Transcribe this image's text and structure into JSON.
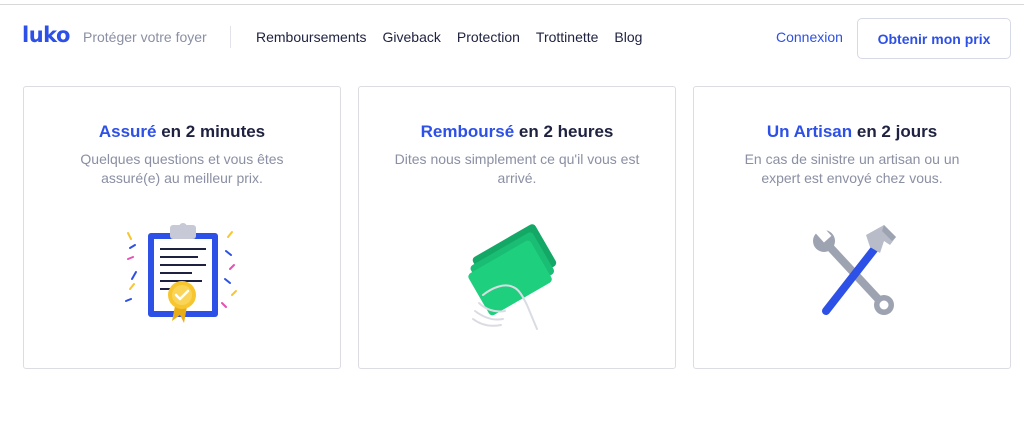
{
  "header": {
    "logo": "luko",
    "tagline": "Protéger votre foyer",
    "nav": [
      "Remboursements",
      "Giveback",
      "Protection",
      "Trottinette",
      "Blog"
    ],
    "login": "Connexion",
    "cta": "Obtenir mon prix"
  },
  "cards": [
    {
      "title_accent": "Assuré",
      "title_rest": " en 2 minutes",
      "description": "Quelques questions et vous êtes assuré(e) au meilleur prix.",
      "icon": "clipboard-certificate-icon"
    },
    {
      "title_accent": "Remboursé",
      "title_rest": " en 2 heures",
      "description": "Dites nous simplement ce qu'il vous est arrivé.",
      "icon": "hand-cash-icon"
    },
    {
      "title_accent": "Un Artisan",
      "title_rest": " en 2 jours",
      "description": "En cas de sinistre un artisan ou un expert est envoyé chez vous.",
      "icon": "wrench-hammer-icon"
    }
  ],
  "colors": {
    "brand_blue": "#2d50e6",
    "navy": "#1e2240",
    "muted_text": "#8a8fa3",
    "money_green": "#1ecf7e",
    "badge_yellow": "#f7c62f"
  }
}
